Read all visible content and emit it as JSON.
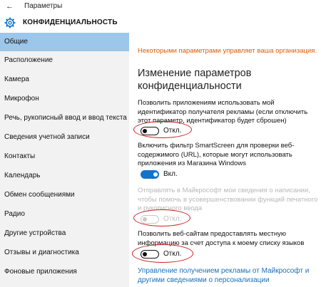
{
  "window": {
    "title": "Параметры"
  },
  "header": {
    "title": "КОНФИДЕНЦИАЛЬНОСТЬ"
  },
  "sidebar": {
    "items": [
      {
        "label": "Общие",
        "selected": true
      },
      {
        "label": "Расположение"
      },
      {
        "label": "Камера"
      },
      {
        "label": "Микрофон"
      },
      {
        "label": "Речь, рукописный ввод и ввод текста"
      },
      {
        "label": "Сведения учетной записи"
      },
      {
        "label": "Контакты"
      },
      {
        "label": "Календарь"
      },
      {
        "label": "Обмен сообщениями"
      },
      {
        "label": "Радио"
      },
      {
        "label": "Другие устройства"
      },
      {
        "label": "Отзывы и диагностика"
      },
      {
        "label": "Фоновые приложения"
      }
    ]
  },
  "main": {
    "org_note": "Некоторыми параметрами управляет ваша организация.",
    "heading": "Изменение параметров конфиденциальности",
    "settings": [
      {
        "description": "Позволить приложениям использовать мой идентификатор получателя рекламы (если отключить этот параметр, идентификатор будет сброшен)",
        "state": "off",
        "state_label": "Откл."
      },
      {
        "description": "Включить фильтр SmartScreen для проверки веб-содержимого (URL), которые могут использовать приложения из Магазина Windows",
        "state": "on",
        "state_label": "Вкл."
      },
      {
        "description": "Отправлять в Майкрософт мои сведения о написании, чтобы помочь в усовершенствовании функций печатного и рукописного ввода",
        "state": "disabled",
        "state_label": "Откл."
      },
      {
        "description": "Позволить веб-сайтам предоставлять местную информацию за счет доступа к моему списку языков",
        "state": "off",
        "state_label": "Откл."
      }
    ],
    "link": "Управление получением рекламы от Майкрософт и другими сведениями о персонализации"
  },
  "colors": {
    "accent": "#1173cc",
    "selected_nav": "#9cc6ea",
    "org_note": "#e05a00",
    "annotation": "#d02020",
    "link": "#1b6fb8"
  }
}
